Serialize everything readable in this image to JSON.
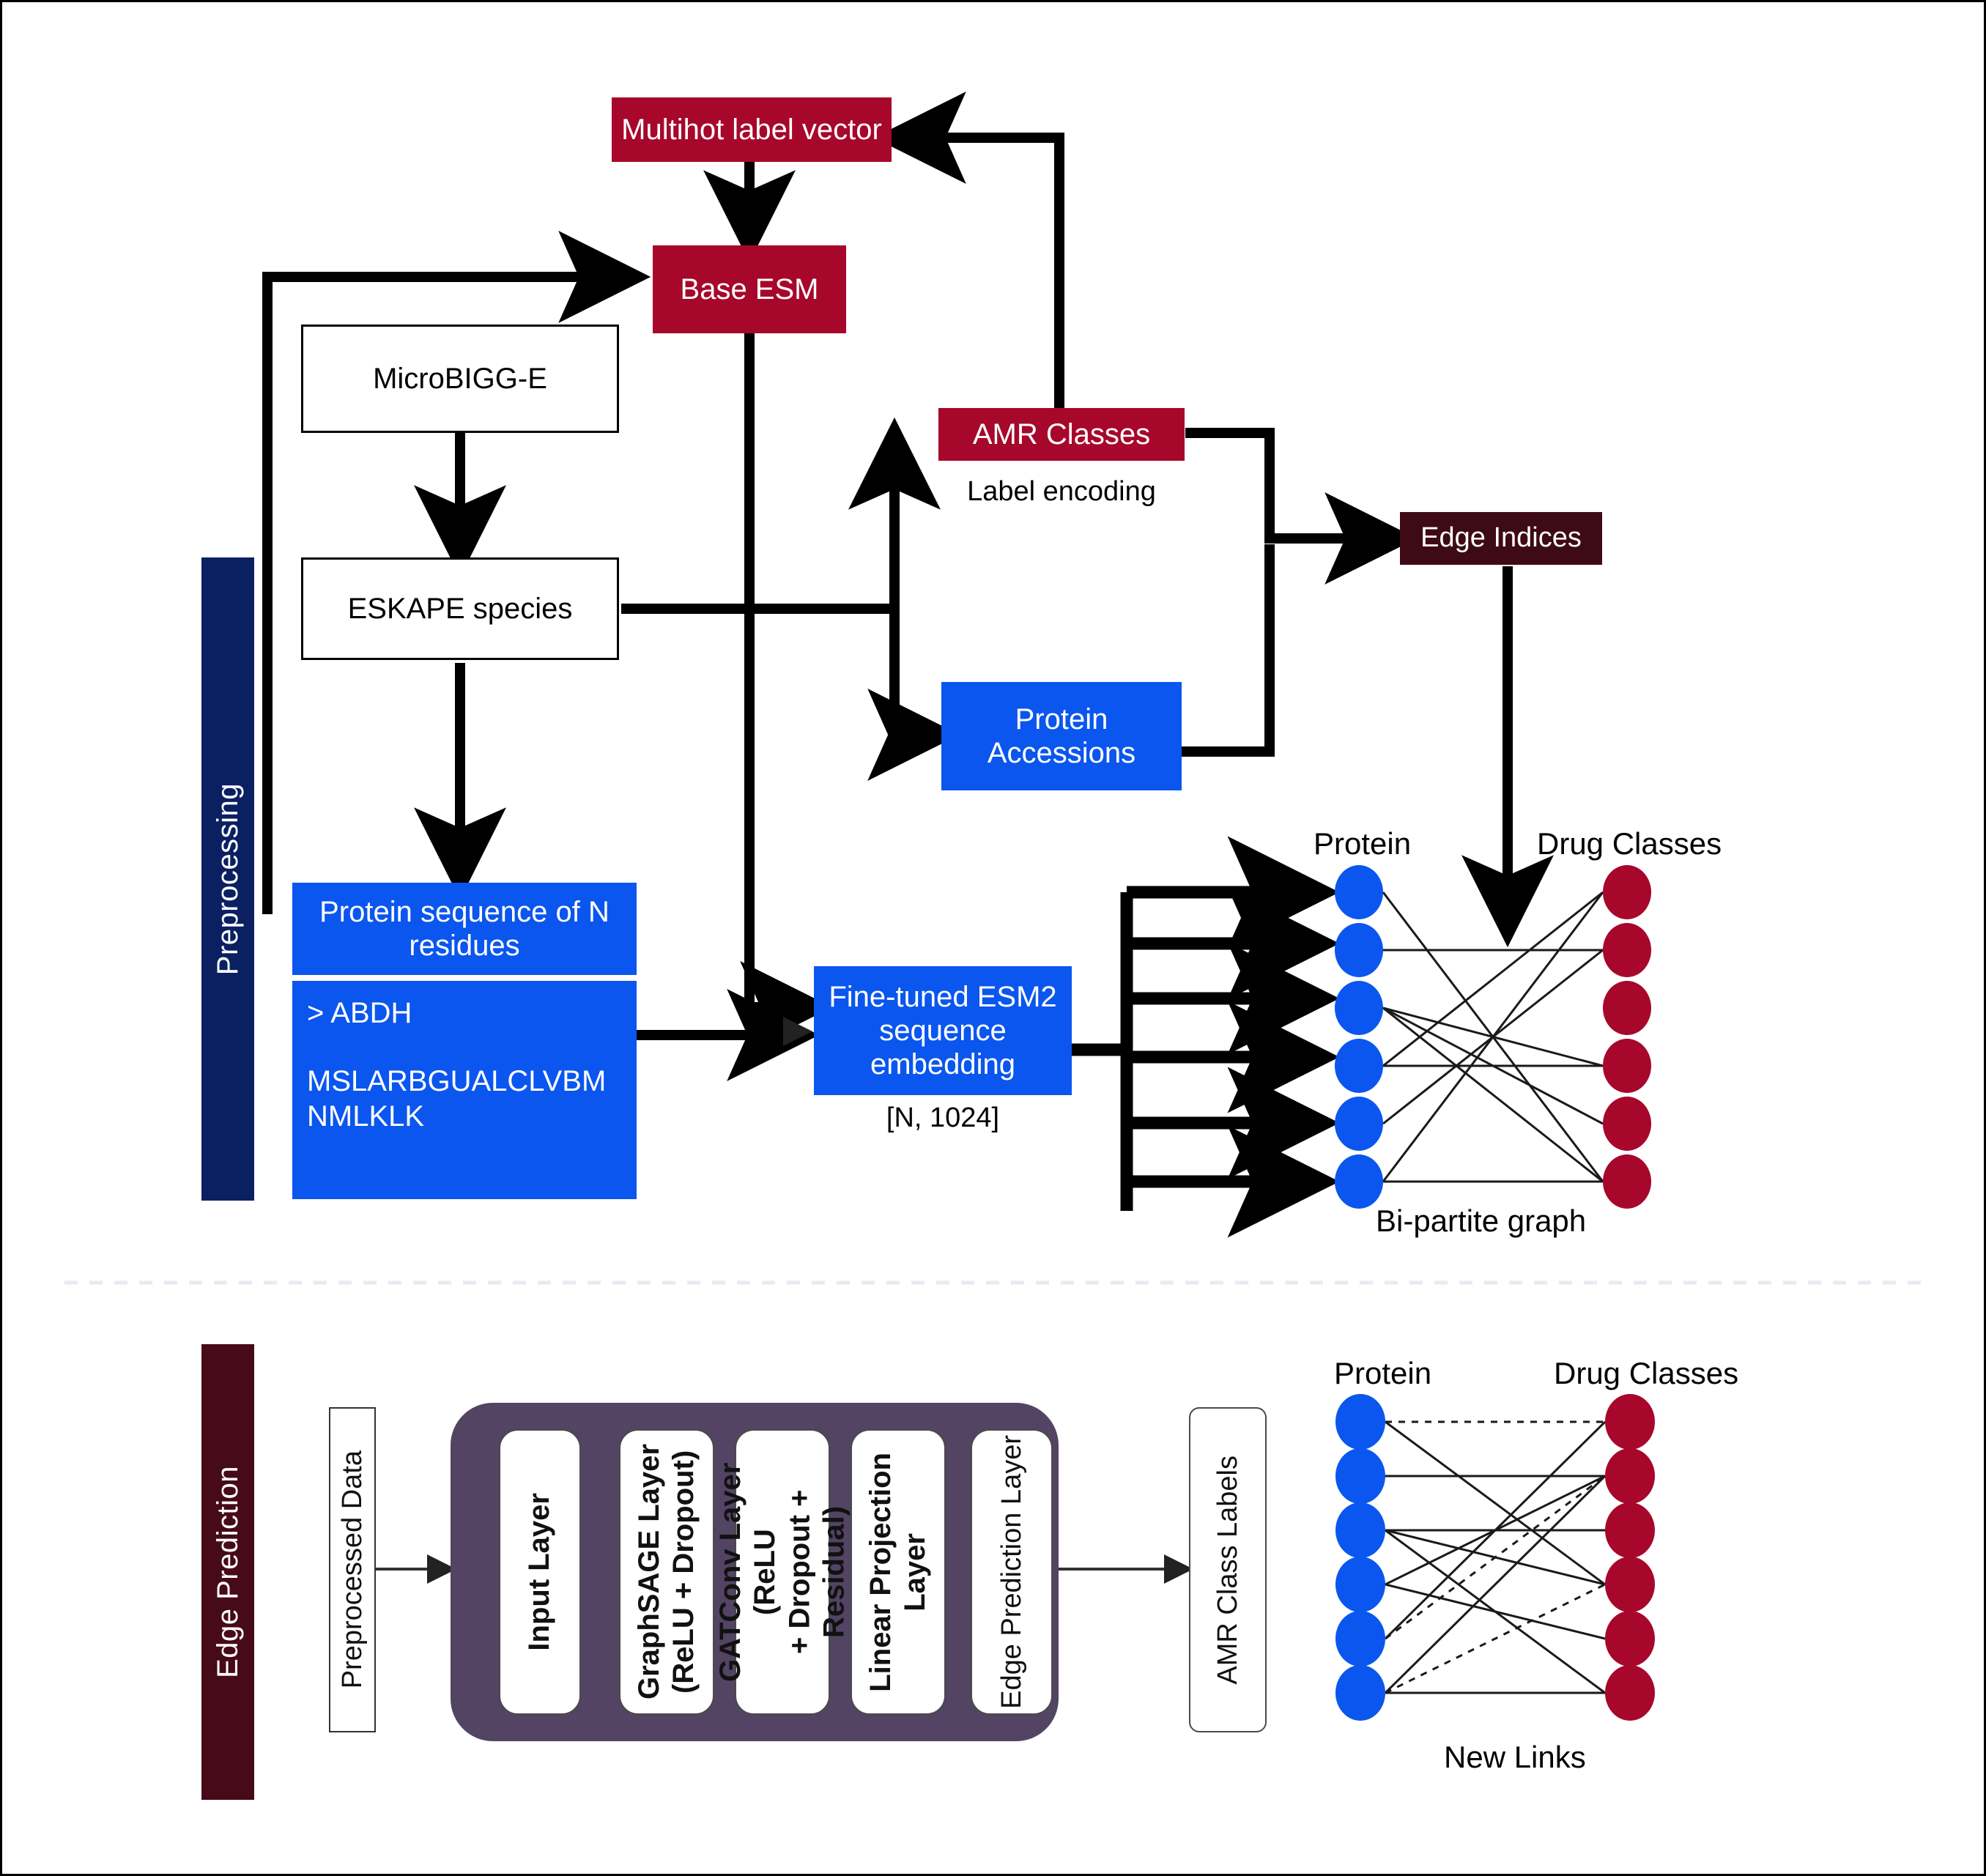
{
  "colors": {
    "crimson": "#A7072B",
    "maroon": "#3E0A14",
    "blue": "#0A56EF",
    "navy_band": "#0A2060",
    "edge_band": "#470A18",
    "pipeline_shell": "#524462",
    "node_protein": "#0A56EF",
    "node_drug": "#A7072B",
    "arrow": "#000000"
  },
  "preprocessing": {
    "band_label": "Preprocessing",
    "multihot_label_vector": "Multihot label vector",
    "base_esm": "Base ESM",
    "microbigge": "MicroBIGG-E",
    "eskape_species": "ESKAPE species",
    "amr_classes": "AMR Classes",
    "label_encoding": "Label encoding",
    "edge_indices": "Edge Indices",
    "protein_accessions": "Protein\nAccessions",
    "protein_accessions_line1": "Protein",
    "protein_accessions_line2": "Accessions",
    "protein_sequence_box": "Protein sequence of N residues",
    "fasta_header": "> ABDH",
    "fasta_sequence": "MSLARBGUALCLVBMNMLKLK",
    "finetuned_esm2": "Fine-tuned ESM2 sequence embedding",
    "embedding_shape": "[N, 1024]",
    "graph": {
      "protein_label": "Protein",
      "drug_label": "Drug Classes",
      "caption": "Bi-partite graph",
      "n_protein_nodes": 6,
      "n_drug_nodes": 6,
      "edges": [
        [
          1,
          6
        ],
        [
          2,
          2
        ],
        [
          3,
          4
        ],
        [
          3,
          5
        ],
        [
          3,
          6
        ],
        [
          4,
          1
        ],
        [
          4,
          4
        ],
        [
          5,
          2
        ],
        [
          6,
          1
        ],
        [
          6,
          6
        ]
      ]
    }
  },
  "edge_prediction": {
    "band_label": "Edge Prediction",
    "preprocessed_data": "Preprocessed Data",
    "layers": [
      {
        "text": "Input Layer",
        "bold": true
      },
      {
        "text": "GraphSAGE Layer\n(ReLU + Dropout)",
        "bold": true
      },
      {
        "text": "GATConv Layer (ReLU\n+ Dropout + Residual)",
        "bold": true
      },
      {
        "text": "Linear Projection\nLayer",
        "bold": true
      },
      {
        "text": "Edge Prediction Layer",
        "bold": false
      }
    ],
    "output_label": "AMR Class Labels",
    "graph": {
      "protein_label": "Protein",
      "drug_label": "Drug Classes",
      "caption": "New Links",
      "n_protein_nodes": 6,
      "n_drug_nodes": 6,
      "solid_edges": [
        [
          1,
          4
        ],
        [
          2,
          2
        ],
        [
          3,
          3
        ],
        [
          3,
          4
        ],
        [
          3,
          6
        ],
        [
          4,
          2
        ],
        [
          4,
          5
        ],
        [
          5,
          1
        ],
        [
          6,
          2
        ],
        [
          6,
          6
        ]
      ],
      "dashed_edges": [
        [
          1,
          1
        ],
        [
          5,
          2
        ],
        [
          6,
          4
        ]
      ]
    }
  }
}
